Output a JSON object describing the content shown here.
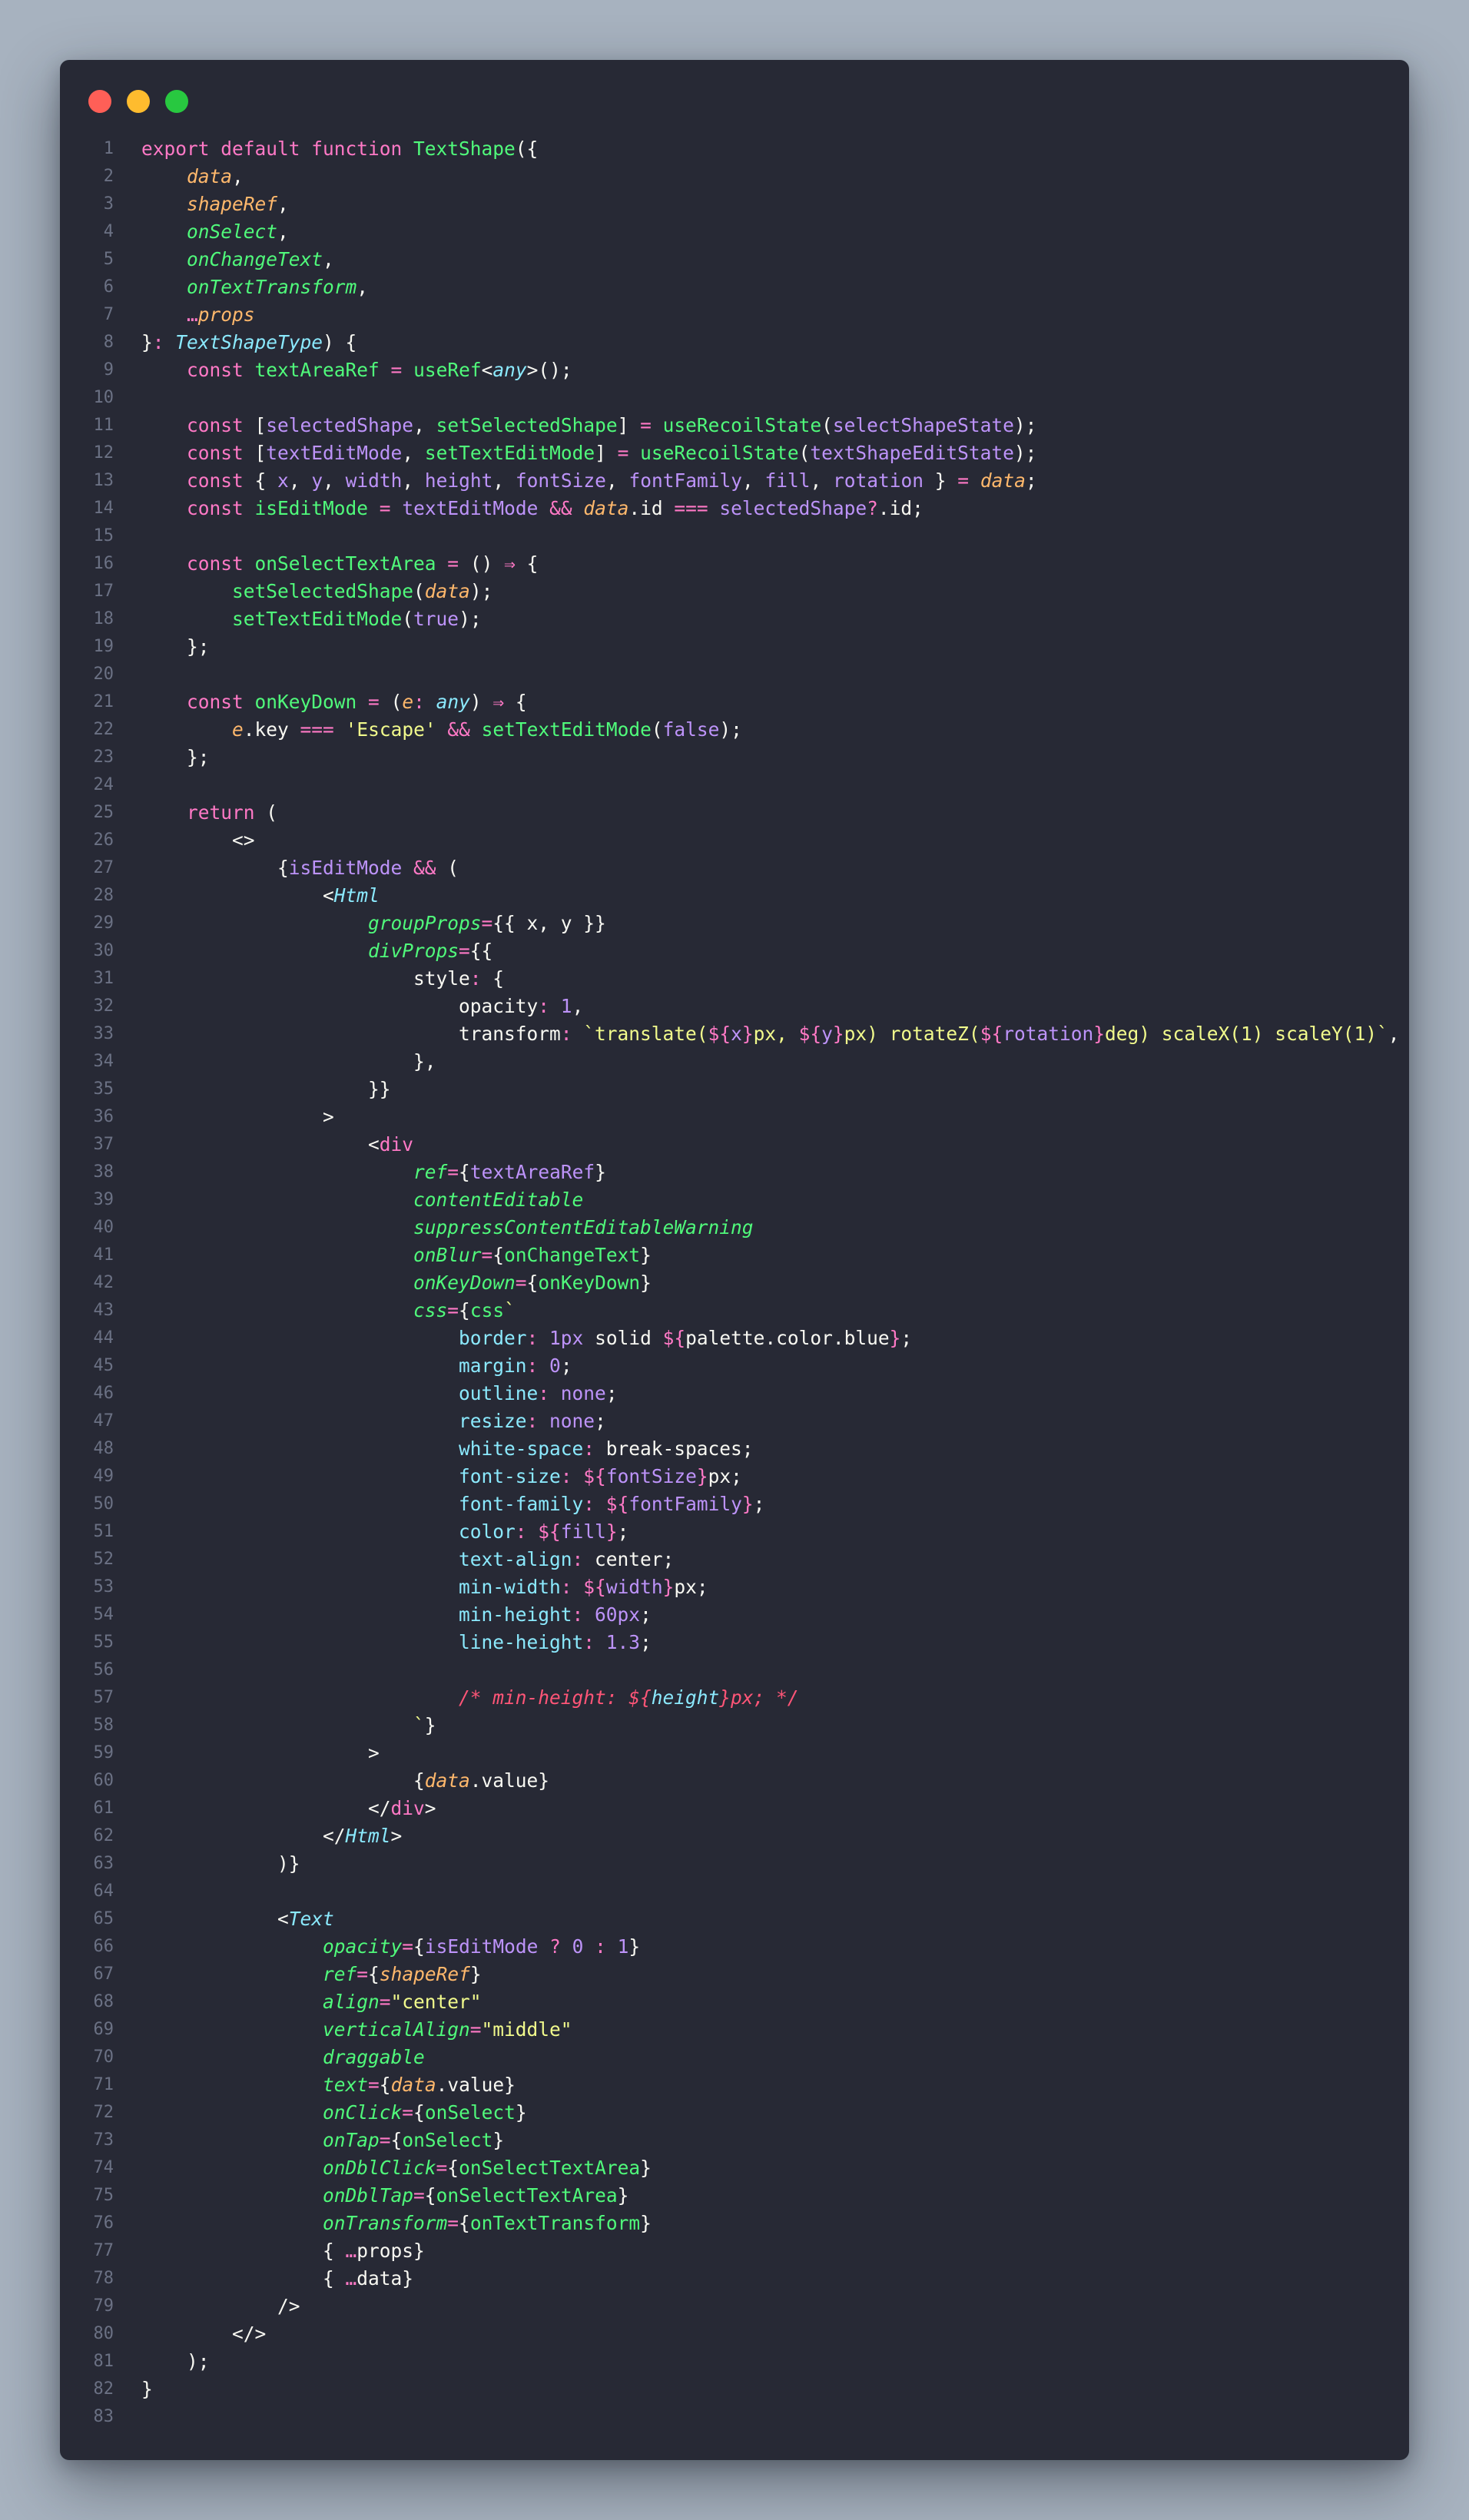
{
  "window": {
    "controls": [
      "close",
      "minimize",
      "maximize"
    ],
    "colors": {
      "close": "#ff5f57",
      "minimize": "#febc2e",
      "maximize": "#28c840"
    }
  },
  "theme": {
    "background": "#272935",
    "keyword": "#ff79c6",
    "function": "#50fa7b",
    "parameter": "#ffb86c",
    "attribute": "#50fa7b",
    "type": "#8be9fd",
    "variable": "#bd93f9",
    "string": "#f1fa8c",
    "comment": "#ff5577",
    "line_number": "#6b7184"
  },
  "code_lines": [
    [
      [
        "k",
        "export default function "
      ],
      [
        "fn",
        "TextShape"
      ],
      [
        "d",
        "({"
      ]
    ],
    [
      [
        "d",
        "    "
      ],
      [
        "p",
        "data"
      ],
      [
        "d",
        ","
      ]
    ],
    [
      [
        "d",
        "    "
      ],
      [
        "p",
        "shapeRef"
      ],
      [
        "d",
        ","
      ]
    ],
    [
      [
        "d",
        "    "
      ],
      [
        "a",
        "onSelect"
      ],
      [
        "d",
        ","
      ]
    ],
    [
      [
        "d",
        "    "
      ],
      [
        "a",
        "onChangeText"
      ],
      [
        "d",
        ","
      ]
    ],
    [
      [
        "d",
        "    "
      ],
      [
        "a",
        "onTextTransform"
      ],
      [
        "d",
        ","
      ]
    ],
    [
      [
        "d",
        "    "
      ],
      [
        "k",
        "…"
      ],
      [
        "p",
        "props"
      ]
    ],
    [
      [
        "d",
        "}"
      ],
      [
        "k",
        ": "
      ],
      [
        "t",
        "TextShapeType"
      ],
      [
        "d",
        ") {"
      ]
    ],
    [
      [
        "d",
        "    "
      ],
      [
        "k",
        "const "
      ],
      [
        "fn",
        "textAreaRef"
      ],
      [
        "k",
        " = "
      ],
      [
        "fn",
        "useRef"
      ],
      [
        "d",
        "<"
      ],
      [
        "t",
        "any"
      ],
      [
        "d",
        ">();"
      ]
    ],
    [],
    [
      [
        "d",
        "    "
      ],
      [
        "k",
        "const "
      ],
      [
        "d",
        "["
      ],
      [
        "v",
        "selectedShape"
      ],
      [
        "d",
        ", "
      ],
      [
        "fn",
        "setSelectedShape"
      ],
      [
        "d",
        "] "
      ],
      [
        "k",
        "= "
      ],
      [
        "fn",
        "useRecoilState"
      ],
      [
        "d",
        "("
      ],
      [
        "v",
        "selectShapeState"
      ],
      [
        "d",
        ");"
      ]
    ],
    [
      [
        "d",
        "    "
      ],
      [
        "k",
        "const "
      ],
      [
        "d",
        "["
      ],
      [
        "v",
        "textEditMode"
      ],
      [
        "d",
        ", "
      ],
      [
        "fn",
        "setTextEditMode"
      ],
      [
        "d",
        "] "
      ],
      [
        "k",
        "= "
      ],
      [
        "fn",
        "useRecoilState"
      ],
      [
        "d",
        "("
      ],
      [
        "v",
        "textShapeEditState"
      ],
      [
        "d",
        ");"
      ]
    ],
    [
      [
        "d",
        "    "
      ],
      [
        "k",
        "const "
      ],
      [
        "d",
        "{ "
      ],
      [
        "v",
        "x"
      ],
      [
        "d",
        ", "
      ],
      [
        "v",
        "y"
      ],
      [
        "d",
        ", "
      ],
      [
        "v",
        "width"
      ],
      [
        "d",
        ", "
      ],
      [
        "v",
        "height"
      ],
      [
        "d",
        ", "
      ],
      [
        "v",
        "fontSize"
      ],
      [
        "d",
        ", "
      ],
      [
        "v",
        "fontFamily"
      ],
      [
        "d",
        ", "
      ],
      [
        "v",
        "fill"
      ],
      [
        "d",
        ", "
      ],
      [
        "v",
        "rotation"
      ],
      [
        "d",
        " } "
      ],
      [
        "k",
        "= "
      ],
      [
        "p",
        "data"
      ],
      [
        "d",
        ";"
      ]
    ],
    [
      [
        "d",
        "    "
      ],
      [
        "k",
        "const "
      ],
      [
        "fn",
        "isEditMode"
      ],
      [
        "k",
        " = "
      ],
      [
        "v",
        "textEditMode"
      ],
      [
        "k",
        " && "
      ],
      [
        "p",
        "data"
      ],
      [
        "d",
        ".id "
      ],
      [
        "k",
        "=== "
      ],
      [
        "v",
        "selectedShape"
      ],
      [
        "k",
        "?"
      ],
      [
        "d",
        ".id;"
      ]
    ],
    [],
    [
      [
        "d",
        "    "
      ],
      [
        "k",
        "const "
      ],
      [
        "fn",
        "onSelectTextArea"
      ],
      [
        "k",
        " = "
      ],
      [
        "d",
        "() "
      ],
      [
        "k",
        "⇒ "
      ],
      [
        "d",
        "{"
      ]
    ],
    [
      [
        "d",
        "        "
      ],
      [
        "fn",
        "setSelectedShape"
      ],
      [
        "d",
        "("
      ],
      [
        "p",
        "data"
      ],
      [
        "d",
        ");"
      ]
    ],
    [
      [
        "d",
        "        "
      ],
      [
        "fn",
        "setTextEditMode"
      ],
      [
        "d",
        "("
      ],
      [
        "v",
        "true"
      ],
      [
        "d",
        ");"
      ]
    ],
    [
      [
        "d",
        "    };"
      ]
    ],
    [],
    [
      [
        "d",
        "    "
      ],
      [
        "k",
        "const "
      ],
      [
        "fn",
        "onKeyDown"
      ],
      [
        "k",
        " = "
      ],
      [
        "d",
        "("
      ],
      [
        "p",
        "e"
      ],
      [
        "k",
        ": "
      ],
      [
        "t",
        "any"
      ],
      [
        "d",
        ") "
      ],
      [
        "k",
        "⇒ "
      ],
      [
        "d",
        "{"
      ]
    ],
    [
      [
        "d",
        "        "
      ],
      [
        "p",
        "e"
      ],
      [
        "d",
        ".key "
      ],
      [
        "k",
        "=== "
      ],
      [
        "s",
        "'Escape'"
      ],
      [
        "k",
        " && "
      ],
      [
        "fn",
        "setTextEditMode"
      ],
      [
        "d",
        "("
      ],
      [
        "v",
        "false"
      ],
      [
        "d",
        ");"
      ]
    ],
    [
      [
        "d",
        "    };"
      ]
    ],
    [],
    [
      [
        "d",
        "    "
      ],
      [
        "k",
        "return "
      ],
      [
        "d",
        "("
      ]
    ],
    [
      [
        "d",
        "        <>"
      ]
    ],
    [
      [
        "d",
        "            {"
      ],
      [
        "v",
        "isEditMode"
      ],
      [
        "k",
        " && "
      ],
      [
        "d",
        "("
      ]
    ],
    [
      [
        "d",
        "                <"
      ],
      [
        "t",
        "Html"
      ]
    ],
    [
      [
        "d",
        "                    "
      ],
      [
        "a",
        "groupProps"
      ],
      [
        "k",
        "="
      ],
      [
        "d",
        "{{ x, y }}"
      ]
    ],
    [
      [
        "d",
        "                    "
      ],
      [
        "a",
        "divProps"
      ],
      [
        "k",
        "="
      ],
      [
        "d",
        "{{"
      ]
    ],
    [
      [
        "d",
        "                        "
      ],
      [
        "d",
        "style"
      ],
      [
        "k",
        ": "
      ],
      [
        "d",
        "{"
      ]
    ],
    [
      [
        "d",
        "                            "
      ],
      [
        "d",
        "opacity"
      ],
      [
        "k",
        ": "
      ],
      [
        "v",
        "1"
      ],
      [
        "d",
        ","
      ]
    ],
    [
      [
        "d",
        "                            "
      ],
      [
        "d",
        "transform"
      ],
      [
        "k",
        ": "
      ],
      [
        "s",
        "`translate("
      ],
      [
        "k",
        "${"
      ],
      [
        "v",
        "x"
      ],
      [
        "k",
        "}"
      ],
      [
        "s",
        "px, "
      ],
      [
        "k",
        "${"
      ],
      [
        "v",
        "y"
      ],
      [
        "k",
        "}"
      ],
      [
        "s",
        "px) rotateZ("
      ],
      [
        "k",
        "${"
      ],
      [
        "v",
        "rotation"
      ],
      [
        "k",
        "}"
      ],
      [
        "s",
        "deg) scaleX(1) scaleY(1)`"
      ],
      [
        "d",
        ","
      ]
    ],
    [
      [
        "d",
        "                        },"
      ]
    ],
    [
      [
        "d",
        "                    }}"
      ]
    ],
    [
      [
        "d",
        "                >"
      ]
    ],
    [
      [
        "d",
        "                    <"
      ],
      [
        "k",
        "div"
      ]
    ],
    [
      [
        "d",
        "                        "
      ],
      [
        "a",
        "ref"
      ],
      [
        "k",
        "="
      ],
      [
        "d",
        "{"
      ],
      [
        "v",
        "textAreaRef"
      ],
      [
        "d",
        "}"
      ]
    ],
    [
      [
        "d",
        "                        "
      ],
      [
        "a",
        "contentEditable"
      ]
    ],
    [
      [
        "d",
        "                        "
      ],
      [
        "a",
        "suppressContentEditableWarning"
      ]
    ],
    [
      [
        "d",
        "                        "
      ],
      [
        "a",
        "onBlur"
      ],
      [
        "k",
        "="
      ],
      [
        "d",
        "{"
      ],
      [
        "fn",
        "onChangeText"
      ],
      [
        "d",
        "}"
      ]
    ],
    [
      [
        "d",
        "                        "
      ],
      [
        "a",
        "onKeyDown"
      ],
      [
        "k",
        "="
      ],
      [
        "d",
        "{"
      ],
      [
        "fn",
        "onKeyDown"
      ],
      [
        "d",
        "}"
      ]
    ],
    [
      [
        "d",
        "                        "
      ],
      [
        "a",
        "css"
      ],
      [
        "k",
        "="
      ],
      [
        "d",
        "{"
      ],
      [
        "fn",
        "css"
      ],
      [
        "s",
        "`"
      ]
    ],
    [
      [
        "d",
        "                            "
      ],
      [
        "pr",
        "border"
      ],
      [
        "k",
        ": "
      ],
      [
        "v",
        "1px"
      ],
      [
        "d",
        " solid "
      ],
      [
        "k",
        "${"
      ],
      [
        "d",
        "palette.color.blue"
      ],
      [
        "k",
        "}"
      ],
      [
        "d",
        ";"
      ]
    ],
    [
      [
        "d",
        "                            "
      ],
      [
        "pr",
        "margin"
      ],
      [
        "k",
        ": "
      ],
      [
        "v",
        "0"
      ],
      [
        "d",
        ";"
      ]
    ],
    [
      [
        "d",
        "                            "
      ],
      [
        "pr",
        "outline"
      ],
      [
        "k",
        ": "
      ],
      [
        "v",
        "none"
      ],
      [
        "d",
        ";"
      ]
    ],
    [
      [
        "d",
        "                            "
      ],
      [
        "pr",
        "resize"
      ],
      [
        "k",
        ": "
      ],
      [
        "v",
        "none"
      ],
      [
        "d",
        ";"
      ]
    ],
    [
      [
        "d",
        "                            "
      ],
      [
        "pr",
        "white-space"
      ],
      [
        "k",
        ": "
      ],
      [
        "d",
        "break-spaces;"
      ]
    ],
    [
      [
        "d",
        "                            "
      ],
      [
        "pr",
        "font-size"
      ],
      [
        "k",
        ": "
      ],
      [
        "k",
        "${"
      ],
      [
        "v",
        "fontSize"
      ],
      [
        "k",
        "}"
      ],
      [
        "d",
        "px;"
      ]
    ],
    [
      [
        "d",
        "                            "
      ],
      [
        "pr",
        "font-family"
      ],
      [
        "k",
        ": "
      ],
      [
        "k",
        "${"
      ],
      [
        "v",
        "fontFamily"
      ],
      [
        "k",
        "}"
      ],
      [
        "d",
        ";"
      ]
    ],
    [
      [
        "d",
        "                            "
      ],
      [
        "pr",
        "color"
      ],
      [
        "k",
        ": "
      ],
      [
        "k",
        "${"
      ],
      [
        "v",
        "fill"
      ],
      [
        "k",
        "}"
      ],
      [
        "d",
        ";"
      ]
    ],
    [
      [
        "d",
        "                            "
      ],
      [
        "pr",
        "text-align"
      ],
      [
        "k",
        ": "
      ],
      [
        "d",
        "center;"
      ]
    ],
    [
      [
        "d",
        "                            "
      ],
      [
        "pr",
        "min-width"
      ],
      [
        "k",
        ": "
      ],
      [
        "k",
        "${"
      ],
      [
        "v",
        "width"
      ],
      [
        "k",
        "}"
      ],
      [
        "d",
        "px;"
      ]
    ],
    [
      [
        "d",
        "                            "
      ],
      [
        "pr",
        "min-height"
      ],
      [
        "k",
        ": "
      ],
      [
        "v",
        "60px"
      ],
      [
        "d",
        ";"
      ]
    ],
    [
      [
        "d",
        "                            "
      ],
      [
        "pr",
        "line-height"
      ],
      [
        "k",
        ": "
      ],
      [
        "v",
        "1.3"
      ],
      [
        "d",
        ";"
      ]
    ],
    [],
    [
      [
        "d",
        "                            "
      ],
      [
        "cm",
        "/* min-height: ${"
      ],
      [
        "t",
        "height"
      ],
      [
        "cm",
        "}px; */"
      ]
    ],
    [
      [
        "d",
        "                        "
      ],
      [
        "s",
        "`"
      ],
      [
        "d",
        "}"
      ]
    ],
    [
      [
        "d",
        "                    >"
      ]
    ],
    [
      [
        "d",
        "                        {"
      ],
      [
        "p",
        "data"
      ],
      [
        "d",
        ".value}"
      ]
    ],
    [
      [
        "d",
        "                    </"
      ],
      [
        "k",
        "div"
      ],
      [
        "d",
        ">"
      ]
    ],
    [
      [
        "d",
        "                </"
      ],
      [
        "t",
        "Html"
      ],
      [
        "d",
        ">"
      ]
    ],
    [
      [
        "d",
        "            )}"
      ]
    ],
    [],
    [
      [
        "d",
        "            <"
      ],
      [
        "t",
        "Text"
      ]
    ],
    [
      [
        "d",
        "                "
      ],
      [
        "a",
        "opacity"
      ],
      [
        "k",
        "="
      ],
      [
        "d",
        "{"
      ],
      [
        "v",
        "isEditMode"
      ],
      [
        "k",
        " ? "
      ],
      [
        "v",
        "0"
      ],
      [
        "k",
        " : "
      ],
      [
        "v",
        "1"
      ],
      [
        "d",
        "}"
      ]
    ],
    [
      [
        "d",
        "                "
      ],
      [
        "a",
        "ref"
      ],
      [
        "k",
        "="
      ],
      [
        "d",
        "{"
      ],
      [
        "p",
        "shapeRef"
      ],
      [
        "d",
        "}"
      ]
    ],
    [
      [
        "d",
        "                "
      ],
      [
        "a",
        "align"
      ],
      [
        "k",
        "="
      ],
      [
        "s",
        "\"center\""
      ]
    ],
    [
      [
        "d",
        "                "
      ],
      [
        "a",
        "verticalAlign"
      ],
      [
        "k",
        "="
      ],
      [
        "s",
        "\"middle\""
      ]
    ],
    [
      [
        "d",
        "                "
      ],
      [
        "a",
        "draggable"
      ]
    ],
    [
      [
        "d",
        "                "
      ],
      [
        "a",
        "text"
      ],
      [
        "k",
        "="
      ],
      [
        "d",
        "{"
      ],
      [
        "p",
        "data"
      ],
      [
        "d",
        ".value}"
      ]
    ],
    [
      [
        "d",
        "                "
      ],
      [
        "a",
        "onClick"
      ],
      [
        "k",
        "="
      ],
      [
        "d",
        "{"
      ],
      [
        "fn",
        "onSelect"
      ],
      [
        "d",
        "}"
      ]
    ],
    [
      [
        "d",
        "                "
      ],
      [
        "a",
        "onTap"
      ],
      [
        "k",
        "="
      ],
      [
        "d",
        "{"
      ],
      [
        "fn",
        "onSelect"
      ],
      [
        "d",
        "}"
      ]
    ],
    [
      [
        "d",
        "                "
      ],
      [
        "a",
        "onDblClick"
      ],
      [
        "k",
        "="
      ],
      [
        "d",
        "{"
      ],
      [
        "fn",
        "onSelectTextArea"
      ],
      [
        "d",
        "}"
      ]
    ],
    [
      [
        "d",
        "                "
      ],
      [
        "a",
        "onDblTap"
      ],
      [
        "k",
        "="
      ],
      [
        "d",
        "{"
      ],
      [
        "fn",
        "onSelectTextArea"
      ],
      [
        "d",
        "}"
      ]
    ],
    [
      [
        "d",
        "                "
      ],
      [
        "a",
        "onTransform"
      ],
      [
        "k",
        "="
      ],
      [
        "d",
        "{"
      ],
      [
        "fn",
        "onTextTransform"
      ],
      [
        "d",
        "}"
      ]
    ],
    [
      [
        "d",
        "                { "
      ],
      [
        "k",
        "…"
      ],
      [
        "d",
        "props}"
      ]
    ],
    [
      [
        "d",
        "                { "
      ],
      [
        "k",
        "…"
      ],
      [
        "d",
        "data}"
      ]
    ],
    [
      [
        "d",
        "            />"
      ]
    ],
    [
      [
        "d",
        "        </>"
      ]
    ],
    [
      [
        "d",
        "    );"
      ]
    ],
    [
      [
        "d",
        "}"
      ]
    ],
    []
  ]
}
